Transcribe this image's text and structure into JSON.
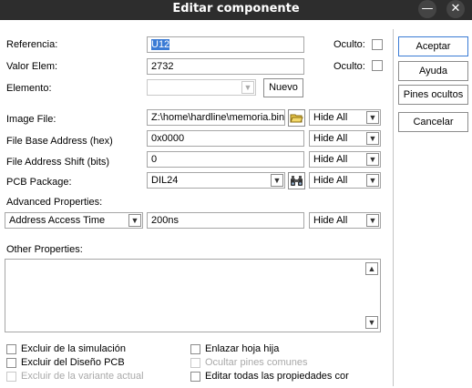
{
  "window": {
    "title": "Editar componente",
    "minimize_glyph": "—",
    "close_glyph": "✕"
  },
  "reference": {
    "label": "Referencia:",
    "value": "U12",
    "hidden_label": "Oculto:"
  },
  "value": {
    "label": "Valor Elem:",
    "value": "2732",
    "hidden_label": "Oculto:"
  },
  "element": {
    "label": "Elemento:",
    "value": "",
    "new_button": "Nuevo"
  },
  "properties": [
    {
      "label": "Image File:",
      "value": "Z:\\home\\hardline\\memoria.bin",
      "visibility": "Hide All"
    },
    {
      "label": "File Base Address (hex)",
      "value": "0x0000",
      "visibility": "Hide All"
    },
    {
      "label": "File Address Shift (bits)",
      "value": "0",
      "visibility": "Hide All"
    },
    {
      "label": "PCB Package:",
      "value": "DIL24",
      "visibility": "Hide All"
    }
  ],
  "advanced": {
    "label": "Advanced Properties:",
    "selected": "Address Access Time",
    "value": "200ns",
    "visibility": "Hide All"
  },
  "other": {
    "label": "Other Properties:",
    "text": ""
  },
  "checkboxes_left": [
    {
      "label": "Excluir de la simulación",
      "enabled": true
    },
    {
      "label": "Excluir del Diseño PCB",
      "enabled": true
    },
    {
      "label": "Excluir de la variante actual",
      "enabled": false
    }
  ],
  "checkboxes_right": [
    {
      "label": "Enlazar hoja hija",
      "enabled": true
    },
    {
      "label": "Ocultar pines comunes",
      "enabled": false
    },
    {
      "label": "Editar todas las propiedades cor",
      "enabled": true
    }
  ],
  "buttons": {
    "accept": "Aceptar",
    "help": "Ayuda",
    "hidden_pins": "Pines ocultos",
    "cancel": "Cancelar"
  },
  "icons": {
    "folder": "folder-open-icon",
    "binoculars": "binoculars-icon",
    "dropdown": "chevron-down-icon",
    "scroll_up": "chevron-up-icon",
    "scroll_down": "chevron-down-icon"
  },
  "colors": {
    "titlebar": "#2d2d2d",
    "selection": "#3a7bd5",
    "folder_icon": "#e9c84a"
  }
}
